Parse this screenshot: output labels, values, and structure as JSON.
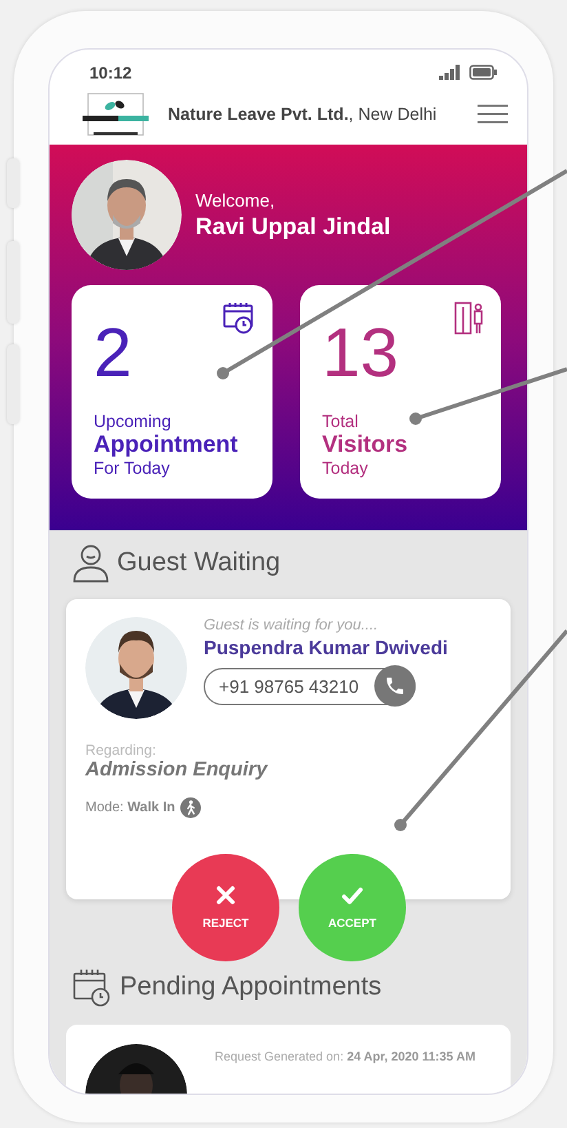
{
  "status_bar": {
    "time": "10:12"
  },
  "header": {
    "company": "**Nature Leave Pvt. Ltd.**, New Delhi"
  },
  "welcome": {
    "greeting": "Welcome,",
    "name": "Ravi Uppal Jindal"
  },
  "stats": [
    {
      "kind": "appointments",
      "count": "2",
      "line_1": "Upcoming",
      "line_2": "Appointment",
      "line_3": "For Today",
      "color": "#4a22b8"
    },
    {
      "kind": "visitors",
      "count": "13",
      "line_1": "Total",
      "line_2": "Visitors",
      "line_3": "Today",
      "color": "#b3307f"
    }
  ],
  "guest_waiting": {
    "title": "Guest Waiting",
    "status": "Guest is waiting for you....",
    "name": "Puspendra Kumar Dwivedi",
    "phone": "+91 98765 43210",
    "regarding_label": "Regarding:",
    "regarding": "Admission Enquiry",
    "mode": "Mode: **Walk In**",
    "actions": [
      {
        "kind": "reject",
        "label": "REJECT"
      },
      {
        "kind": "accept",
        "label": "ACCEPT"
      }
    ]
  },
  "pending_appointments": {
    "title": "Pending Appointments",
    "items": [
      {
        "request": "Request Generated on: **24 Apr, 2020 11:35 AM**"
      }
    ]
  }
}
